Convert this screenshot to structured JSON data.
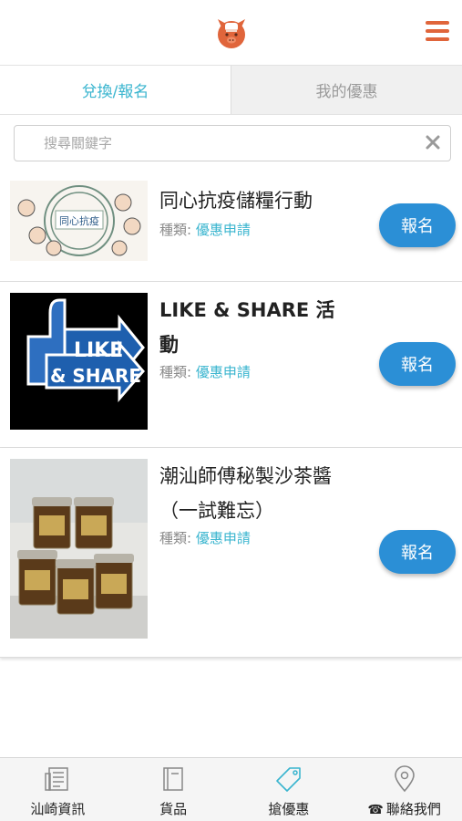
{
  "header": {
    "logo_icon": "pig-chef-logo-icon",
    "menu_icon": "hamburger-menu-icon",
    "accent_color": "#e0653b"
  },
  "tabs": [
    {
      "label": "兌換/報名",
      "active": true
    },
    {
      "label": "我的優惠",
      "active": false
    }
  ],
  "search": {
    "placeholder": "搜尋關鍵字",
    "value": ""
  },
  "items": [
    {
      "title": "同心抗疫儲糧行動",
      "type_label": "種類:",
      "type_value": "優惠申請",
      "button_label": "報名",
      "image_text": "同心抗疫"
    },
    {
      "title": "LIKE & SHARE 活動",
      "type_label": "種類:",
      "type_value": "優惠申請",
      "button_label": "報名",
      "image_text_1": "LIKE",
      "image_text_2": "& SHARE"
    },
    {
      "title": "潮汕師傅秘製沙茶醬（一試難忘）",
      "type_label": "種類:",
      "type_value": "優惠申請",
      "button_label": "報名"
    }
  ],
  "bottom_nav": [
    {
      "label": "汕崎資訊",
      "icon": "newspaper-icon"
    },
    {
      "label": "貨品",
      "icon": "book-icon"
    },
    {
      "label": "搶優惠",
      "icon": "tag-icon",
      "active": true
    },
    {
      "label": "聯絡我們",
      "icon": "location-pin-icon",
      "prefix_icon": "telephone-icon"
    }
  ],
  "colors": {
    "tab_active_text": "#3ab5cf",
    "button_bg": "#2b8fd6",
    "nav_active_icon": "#3ab5cf"
  }
}
